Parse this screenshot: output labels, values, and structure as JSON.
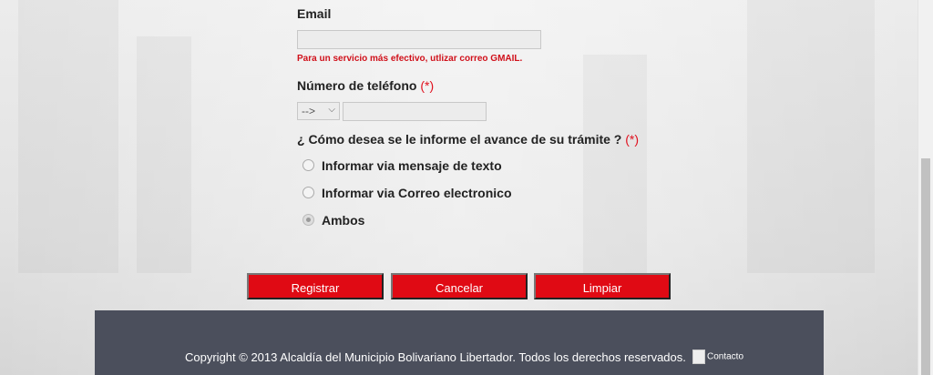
{
  "form": {
    "email_label": "Email",
    "email_value": "",
    "email_hint": "Para un servicio más efectivo, utlizar correo GMAIL.",
    "phone_label": "Número de teléfono",
    "required_mark": "(*)",
    "phone_prefix_selected": "-->",
    "phone_value": "",
    "notify_question": "¿ Cómo desea se le informe el avance de su trámite ?",
    "options": [
      {
        "label": "Informar via mensaje de texto",
        "checked": false
      },
      {
        "label": "Informar via Correo electronico",
        "checked": false
      },
      {
        "label": "Ambos",
        "checked": true
      }
    ]
  },
  "buttons": {
    "register": "Registrar",
    "cancel": "Cancelar",
    "clear": "Limpiar"
  },
  "footer": {
    "copyright": "Copyright © 2013 Alcaldía del Municipio Bolivariano Libertador. Todos los derechos reservados.",
    "contact": "Contacto"
  },
  "colors": {
    "accent": "#e00a14",
    "footer_bg": "#4b4f5c",
    "error_text": "#d0101a"
  }
}
